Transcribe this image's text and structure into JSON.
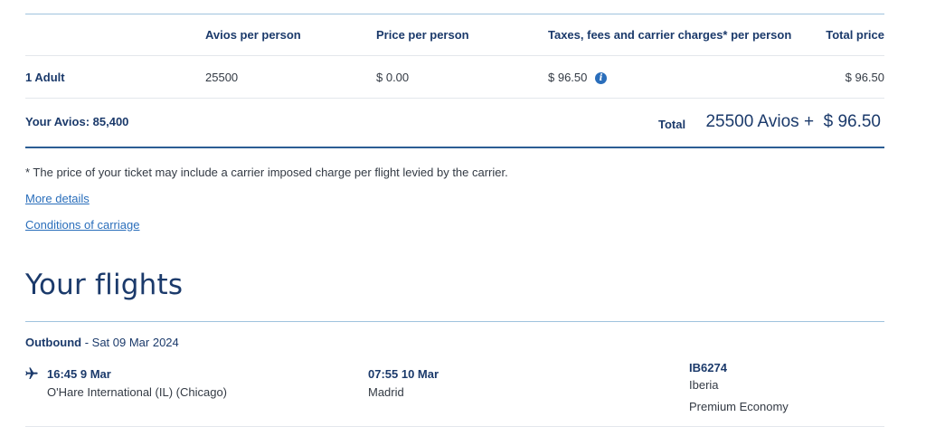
{
  "fare_table": {
    "headers": {
      "avios": "Avios per person",
      "price": "Price per person",
      "taxes": "Taxes, fees and carrier charges* per person",
      "total": "Total price"
    },
    "row": {
      "passenger": "1 Adult",
      "avios": "25500",
      "price": "$ 0.00",
      "taxes": "$ 96.50",
      "total": "$ 96.50"
    }
  },
  "summary": {
    "your_avios": "Your Avios: 85,400",
    "total_label": "Total",
    "total_value": "25500 Avios +  $ 96.50"
  },
  "footnote": "* The price of your ticket may include a carrier imposed charge per flight levied by the carrier.",
  "links": {
    "more_details": "More details",
    "conditions": "Conditions of carriage"
  },
  "flights": {
    "heading": "Your flights",
    "outbound_label": "Outbound",
    "outbound_date": " - Sat 09 Mar 2024",
    "departure_time": "16:45 9 Mar",
    "departure_airport": "O'Hare International (IL) (Chicago)",
    "arrival_time": "07:55 10 Mar",
    "arrival_airport": "Madrid",
    "flight_number": "IB6274",
    "airline": "Iberia",
    "cabin": "Premium Economy"
  },
  "icons": {
    "info": "info-icon",
    "plane": "plane-icon"
  },
  "colors": {
    "navy": "#1b3a6b",
    "link": "#2a6ebb",
    "rule": "#2c5d94"
  }
}
